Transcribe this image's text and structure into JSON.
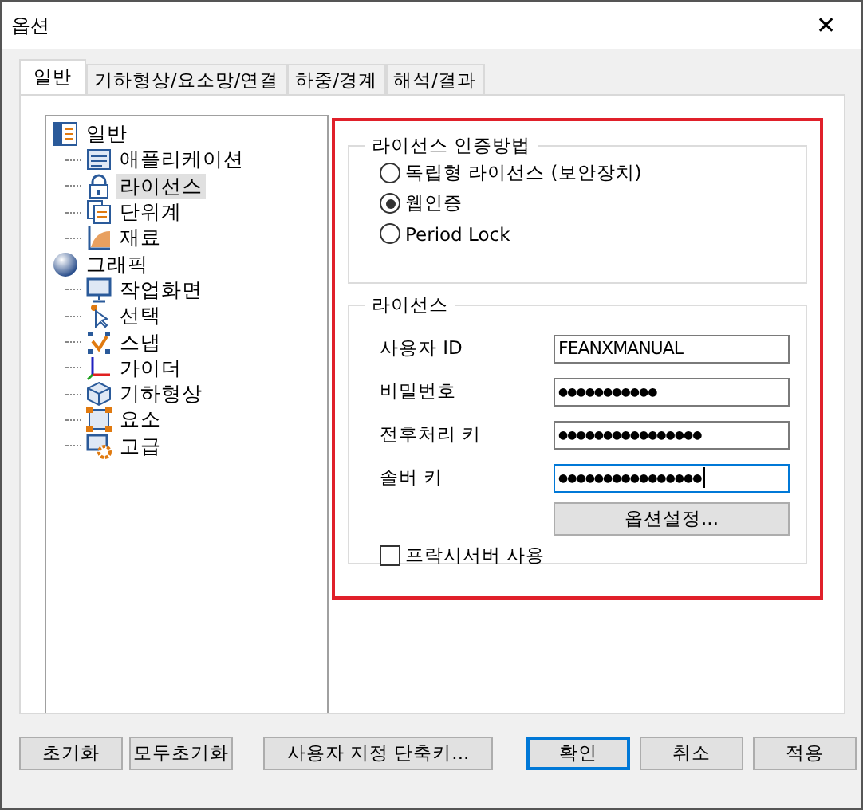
{
  "window": {
    "title": "옵션",
    "close": "✕"
  },
  "tabs": [
    {
      "label": "일반",
      "selected": true
    },
    {
      "label": "기하형상/요소망/연결",
      "selected": false
    },
    {
      "label": "하중/경계",
      "selected": false
    },
    {
      "label": "해석/결과",
      "selected": false
    }
  ],
  "tree": [
    {
      "label": "일반",
      "selected": false,
      "children": [
        {
          "label": "애플리케이션",
          "selected": false
        },
        {
          "label": "라이선스",
          "selected": true
        },
        {
          "label": "단위계",
          "selected": false
        },
        {
          "label": "재료",
          "selected": false
        }
      ]
    },
    {
      "label": "그래픽",
      "selected": false,
      "children": [
        {
          "label": "작업화면",
          "selected": false
        },
        {
          "label": "선택",
          "selected": false
        },
        {
          "label": "스냅",
          "selected": false
        },
        {
          "label": "가이더",
          "selected": false
        },
        {
          "label": "기하형상",
          "selected": false
        },
        {
          "label": "요소",
          "selected": false
        },
        {
          "label": "고급",
          "selected": false
        }
      ]
    }
  ],
  "auth_group": {
    "title": "라이선스 인증방법",
    "options": [
      {
        "label": "독립형 라이선스 (보안장치)",
        "selected": false
      },
      {
        "label": "웹인증",
        "selected": true
      },
      {
        "label": "Period Lock",
        "selected": false
      }
    ]
  },
  "license_group": {
    "title": "라이선스",
    "fields": [
      {
        "kind": "text",
        "label": "사용자 ID",
        "value": "FEANXMANUAL",
        "focused": false
      },
      {
        "kind": "password",
        "label": "비밀번호",
        "value": "●●●●●●●●●●●",
        "focused": false
      },
      {
        "kind": "password",
        "label": "전후처리 키",
        "value": "●●●●●●●●●●●●●●●●",
        "focused": false
      },
      {
        "kind": "password",
        "label": "솔버 키",
        "value": "●●●●●●●●●●●●●●●●",
        "focused": true
      }
    ],
    "options_button": "옵션설정...",
    "proxy": {
      "label": "프락시서버 사용",
      "checked": false
    }
  },
  "buttons": [
    {
      "label": "초기화",
      "default": false
    },
    {
      "label": "모두초기화",
      "default": false
    },
    {
      "label": "사용자 지정 단축키...",
      "default": false
    },
    {
      "label": "확인",
      "default": true
    },
    {
      "label": "취소",
      "default": false
    },
    {
      "label": "적용",
      "default": false
    }
  ]
}
